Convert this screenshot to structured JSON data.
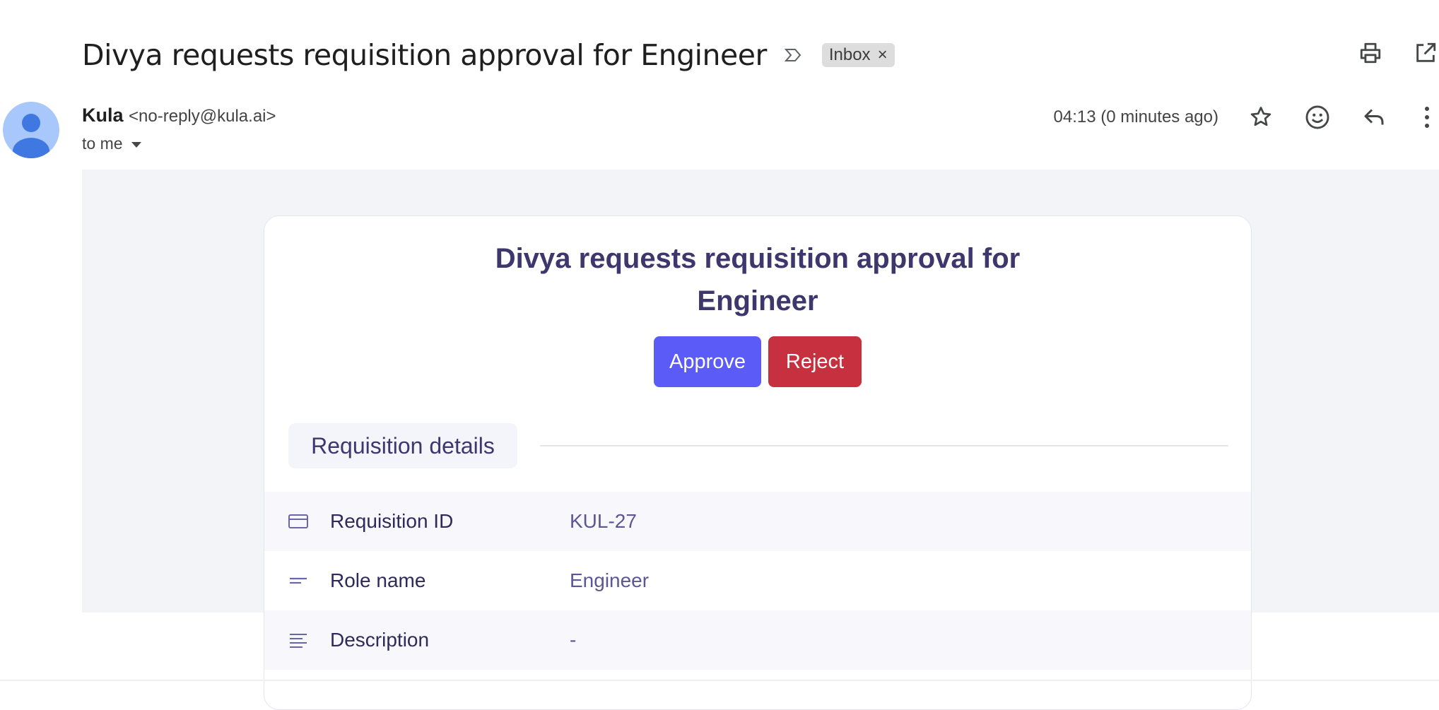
{
  "email": {
    "subject": "Divya requests requisition approval for Engineer",
    "label_chip": "Inbox",
    "label_remove": "×",
    "sender_name": "Kula",
    "sender_email": "<no-reply@kula.ai>",
    "recipient": "to me",
    "timestamp": "04:13 (0 minutes ago)"
  },
  "icons": {
    "importance": "importance-marker-icon",
    "print": "print-icon",
    "open_new_window": "open-in-new-window-icon",
    "star": "star-icon",
    "emoji": "emoji-icon",
    "reply": "reply-icon",
    "more": "more-vert-icon",
    "dropdown": "caret-down-icon"
  },
  "card": {
    "title_line1": "Divya requests requisition approval for",
    "title_line2": "Engineer",
    "approve_label": "Approve",
    "reject_label": "Reject",
    "section_title": "Requisition details",
    "rows": [
      {
        "icon": "card-icon",
        "label": "Requisition ID",
        "value": "KUL-27"
      },
      {
        "icon": "short-text-icon",
        "label": "Role name",
        "value": "Engineer"
      },
      {
        "icon": "notes-icon",
        "label": "Description",
        "value": "-"
      }
    ]
  },
  "colors": {
    "approve": "#5b5cf7",
    "reject": "#c7313f",
    "card_title": "#3e376e",
    "mail_bg": "#f3f4f8",
    "avatar": "#a8c7fa"
  }
}
